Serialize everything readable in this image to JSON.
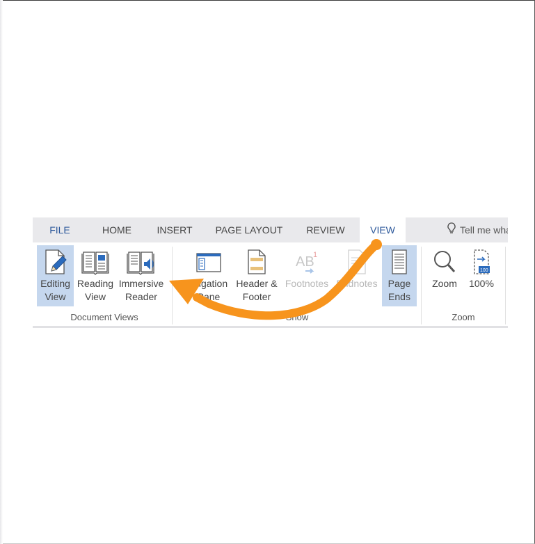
{
  "ribbon": {
    "tabs": {
      "file": "FILE",
      "home": "HOME",
      "insert": "INSERT",
      "page_layout": "PAGE LAYOUT",
      "review": "REVIEW",
      "view": "VIEW"
    },
    "tell_me": "Tell me what yo",
    "groups": {
      "document_views": {
        "label": "Document Views",
        "editing_view": "Editing\nView",
        "reading_view": "Reading\nView",
        "immersive_reader": "Immersive\nReader"
      },
      "show": {
        "label": "Show",
        "navigation_pane": "vigation\nPane",
        "header_footer": "Header &\nFooter",
        "footnotes": "Footnotes",
        "endnotes": "Endnotes",
        "page_ends": "Page\nEnds"
      },
      "zoom": {
        "label": "Zoom",
        "zoom": "Zoom",
        "hundred": "100%"
      }
    }
  },
  "colors": {
    "accent": "#2b579a",
    "selected_bg": "#c5d7ee",
    "tabbar_bg": "#e9e9ec",
    "arrow": "#f7941d"
  },
  "icons": {
    "editing_view": "document-pencil-icon",
    "reading_view": "open-book-icon",
    "immersive_reader": "book-speaker-icon",
    "navigation_pane": "navigation-pane-icon",
    "header_footer": "header-footer-icon",
    "footnotes": "footnote-icon",
    "endnotes": "endnote-icon",
    "page_ends": "page-ends-icon",
    "zoom": "magnifier-icon",
    "hundred": "zoom-100-icon",
    "tell_me": "lightbulb-icon",
    "annotation": "curved-arrow-icon"
  }
}
